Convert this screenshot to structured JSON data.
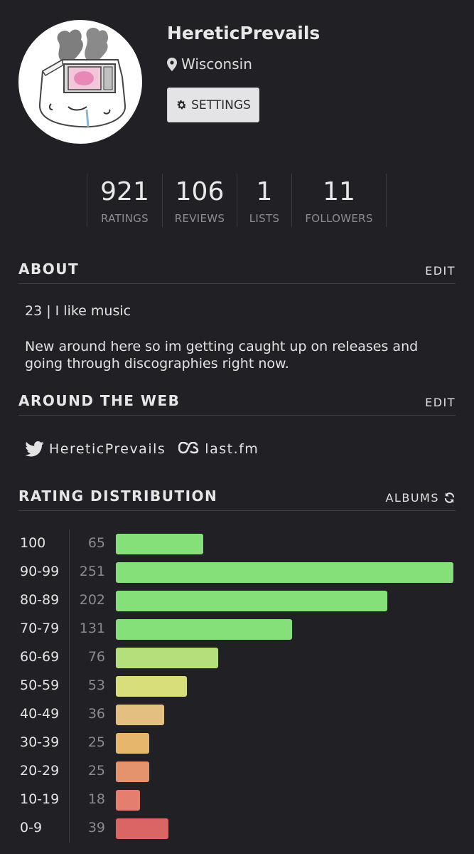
{
  "profile": {
    "username": "HereticPrevails",
    "location": "Wisconsin",
    "settings_label": "SETTINGS"
  },
  "stats": [
    {
      "value": "921",
      "label": "RATINGS"
    },
    {
      "value": "106",
      "label": "REVIEWS"
    },
    {
      "value": "1",
      "label": "LISTS"
    },
    {
      "value": "11",
      "label": "FOLLOWERS"
    }
  ],
  "about": {
    "title": "ABOUT",
    "edit_label": "EDIT",
    "line1": "23 | I like music",
    "line2": "New around here so im getting caught up on releases and going through discographies right now."
  },
  "web": {
    "title": "AROUND THE WEB",
    "edit_label": "EDIT",
    "twitter": "HereticPrevails",
    "lastfm": "last.fm"
  },
  "distribution": {
    "title": "RATING DISTRIBUTION",
    "filter_label": "ALBUMS",
    "max": 251,
    "rows": [
      {
        "label": "100",
        "count": 65,
        "color": "#86e07a"
      },
      {
        "label": "90-99",
        "count": 251,
        "color": "#86e07a"
      },
      {
        "label": "80-89",
        "count": 202,
        "color": "#86e07a"
      },
      {
        "label": "70-79",
        "count": 131,
        "color": "#86e07a"
      },
      {
        "label": "60-69",
        "count": 76,
        "color": "#b3e07a"
      },
      {
        "label": "50-59",
        "count": 53,
        "color": "#d8df7a"
      },
      {
        "label": "40-49",
        "count": 36,
        "color": "#e3bf82"
      },
      {
        "label": "30-39",
        "count": 25,
        "color": "#e5b66b"
      },
      {
        "label": "20-29",
        "count": 25,
        "color": "#e5936c"
      },
      {
        "label": "10-19",
        "count": 18,
        "color": "#e47f6f"
      },
      {
        "label": "0-9",
        "count": 39,
        "color": "#d96565"
      }
    ]
  }
}
